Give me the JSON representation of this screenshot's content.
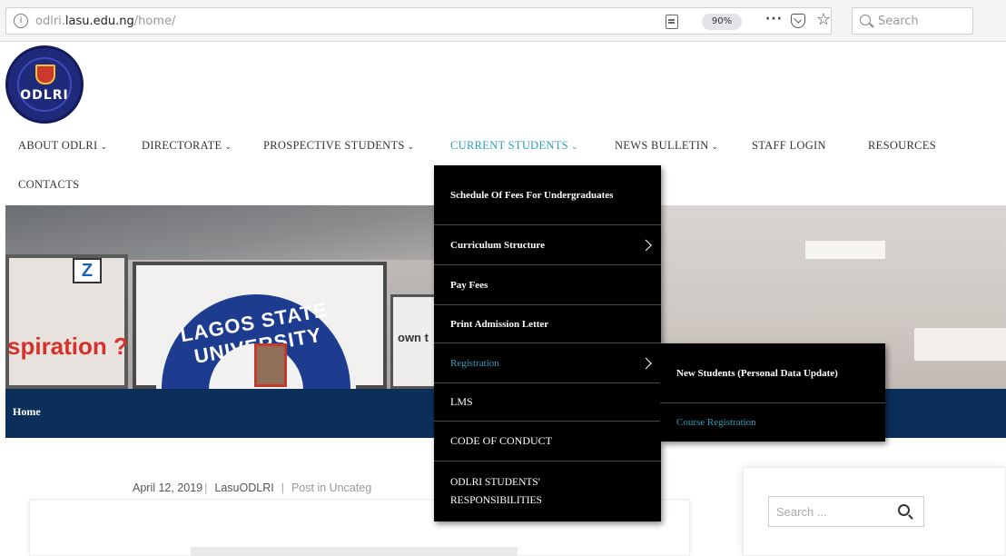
{
  "browser": {
    "url_prefix": "odlri.",
    "url_host": "lasu.edu.ng",
    "url_path": "/home/",
    "zoom": "90%",
    "more": "···",
    "search_placeholder": "Search"
  },
  "logo": {
    "text": "ODLRI"
  },
  "nav": {
    "items": [
      {
        "label": "ABOUT ODLRI",
        "caret": "⌄"
      },
      {
        "label": "DIRECTORATE",
        "caret": "⌄"
      },
      {
        "label": "PROSPECTIVE STUDENTS",
        "caret": "⌄"
      },
      {
        "label": "CURRENT STUDENTS",
        "caret": "⌄"
      },
      {
        "label": "NEWS BULLETIN",
        "caret": "⌄"
      },
      {
        "label": "STAFF LOGIN"
      },
      {
        "label": "RESOURCES"
      },
      {
        "label": "CONTACTS"
      }
    ]
  },
  "dropdown": {
    "items": [
      {
        "label": "Schedule Of Fees For Undergraduates"
      },
      {
        "label": "Curriculum Structure"
      },
      {
        "label": "Pay Fees"
      },
      {
        "label": "Print Admission Letter"
      },
      {
        "label": "Registration"
      },
      {
        "label": "LMS"
      },
      {
        "label": "CODE OF CONDUCT"
      },
      {
        "label": "ODLRI STUDENTS' RESPONSIBILITIES"
      }
    ],
    "sub_items": [
      {
        "label": "New Students (Personal Data Update)"
      },
      {
        "label": "Course Registration"
      }
    ]
  },
  "hero": {
    "seal_text": "LAGOS STATE UNIVERSITY",
    "sign_text": "spiration ?",
    "z_text": "Z",
    "own_text": "own t"
  },
  "breadcrumb": {
    "home": "Home"
  },
  "post": {
    "date": "April 12, 2019",
    "author": "LasuODLRI",
    "category": "Post in Uncateg"
  },
  "sidebar": {
    "search_placeholder": "Search ..."
  }
}
